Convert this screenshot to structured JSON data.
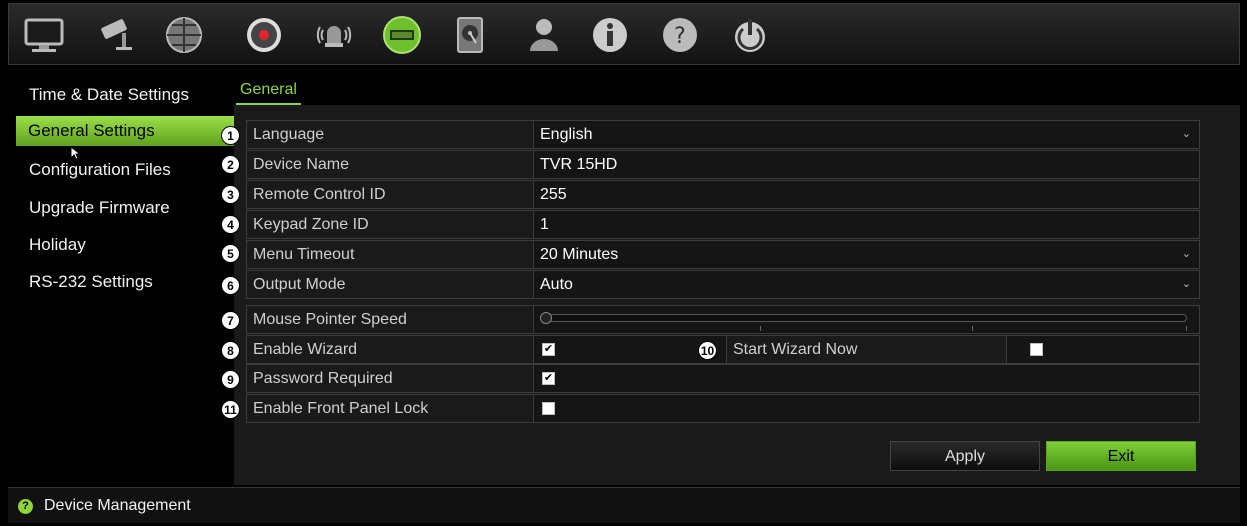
{
  "toolbar": {
    "icons": [
      "monitor-icon",
      "camera-icon",
      "network-icon",
      "record-icon",
      "alarm-icon",
      "device-icon",
      "hdd-icon",
      "user-icon",
      "info-icon",
      "help-icon",
      "power-icon"
    ]
  },
  "sidebar": {
    "items": [
      {
        "label": "Time & Date Settings"
      },
      {
        "label": "General Settings"
      },
      {
        "label": "Configuration Files"
      },
      {
        "label": "Upgrade Firmware"
      },
      {
        "label": "Holiday"
      },
      {
        "label": "RS-232 Settings"
      }
    ],
    "active_index": 1
  },
  "tabs": [
    {
      "label": "General"
    }
  ],
  "settings": {
    "language": {
      "num": "1",
      "label": "Language",
      "value": "English"
    },
    "device_name": {
      "num": "2",
      "label": "Device Name",
      "value": "TVR 15HD"
    },
    "remote_control_id": {
      "num": "3",
      "label": "Remote Control ID",
      "value": "255"
    },
    "keypad_zone_id": {
      "num": "4",
      "label": "Keypad Zone ID",
      "value": "1"
    },
    "menu_timeout": {
      "num": "5",
      "label": "Menu Timeout",
      "value": "20 Minutes"
    },
    "output_mode": {
      "num": "6",
      "label": "Output Mode",
      "value": "Auto"
    },
    "mouse_pointer_speed": {
      "num": "7",
      "label": "Mouse Pointer Speed",
      "level": 0
    },
    "enable_wizard": {
      "num": "8",
      "label": "Enable Wizard",
      "checked": true
    },
    "start_wizard_now": {
      "num": "10",
      "label": "Start Wizard Now",
      "checked": false
    },
    "password_required": {
      "num": "9",
      "label": "Password Required",
      "checked": true
    },
    "front_panel_lock": {
      "num": "11",
      "label": "Enable Front Panel Lock",
      "checked": false
    }
  },
  "buttons": {
    "apply": "Apply",
    "exit": "Exit"
  },
  "status": {
    "text": "Device Management",
    "icon": "?"
  },
  "colors": {
    "accent": "#8fd43a",
    "background": "#000000"
  }
}
